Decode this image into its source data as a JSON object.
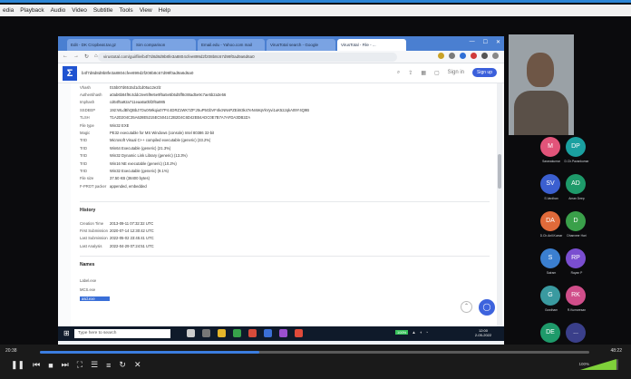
{
  "menubar": [
    "edia",
    "Playback",
    "Audio",
    "Video",
    "Subtitle",
    "Tools",
    "View",
    "Help"
  ],
  "browser": {
    "tabs": [
      {
        "label": "Edit - DK Cropbeat.tar.gz"
      },
      {
        "label": "Sim comparison"
      },
      {
        "label": "Email.edu - Yahoo.com mail"
      },
      {
        "label": "VirusTotal search - Google"
      },
      {
        "label": "VirusTotal - File - ..."
      }
    ],
    "url": "virustotal.com/gui/file/b4f7d8d8d9b8fe3a8804cfee899d2f208b8c67d99f0ad9a6d6a0",
    "window_buttons": [
      "—",
      "☐",
      "✕"
    ]
  },
  "vt": {
    "logo": "Σ",
    "search_value": "b4f7d8d8d9b8fe3a8804cfee899d2f208b8c67d99f0ad9a6d6a0",
    "sign_in": "Sign in",
    "sign_up": "Sign up",
    "details": [
      {
        "k": "Vhash",
        "v": "015b07d6515d1d1d05a12e2lz"
      },
      {
        "k": "Authentihash",
        "v": "a0ab6b84f9c4ddc3ee5f9e5e9f5a5e5b5d5ff8c88ad5e9c7ae5b2a3e56"
      },
      {
        "k": "Imphash",
        "v": "cd64f5a92a711eaa6a0bf2f6a985"
      },
      {
        "k": "SSDEEP",
        "v": "192:WLdBhQBbJ7Ou0rMkqiu07P4:4DRZ1WK7ZP:z5uP5GbVF4kcNNsPZEi8r3k47eNnMqVkVyvi1uK52JqkA09Y4Q9B"
      },
      {
        "k": "TLSH",
        "v": "T1A2D204C35A628E5215EC5041C2B2D4C6D42EB4ADC0E7B7A7AFDA3DB2ZA"
      },
      {
        "k": "File type",
        "v": "Win32 EXE"
      },
      {
        "k": "Magic",
        "v": "PE32 executable for MS Windows (console) Intel 80386 32-bit"
      },
      {
        "k": "TrID",
        "v": "Microsoft Visual C++ compiled executable (generic) (33.2%)"
      },
      {
        "k": "TrID",
        "v": "Win64 Executable (generic) (21.3%)"
      },
      {
        "k": "TrID",
        "v": "Win32 Dynamic Link Library (generic) (13.3%)"
      },
      {
        "k": "TrID",
        "v": "Win16 NE executable (generic) (10.2%)"
      },
      {
        "k": "TrID",
        "v": "Win32 Executable (generic) (9.1%)"
      },
      {
        "k": "File size",
        "v": "37.50 KB (38400 bytes)"
      },
      {
        "k": "F-PROT packer",
        "v": "appended, embedded"
      }
    ],
    "history_title": "History",
    "history": [
      {
        "k": "Creation Time",
        "v": "2013-09-11 07:32:32 UTC"
      },
      {
        "k": "First Submission",
        "v": "2020-07-14 12:30:42 UTC"
      },
      {
        "k": "Last Submission",
        "v": "2022-05-02 23:45:41 UTC"
      },
      {
        "k": "Last Analysis",
        "v": "2022-04-29 07:24:51 UTC"
      }
    ],
    "names_title": "Names",
    "names": [
      {
        "k": "Label.exe",
        "v": ""
      },
      {
        "k": "MCS.exe",
        "v": ""
      },
      {
        "k": "asd.exe",
        "v": ""
      }
    ],
    "scroll_top_icon": "⌃",
    "chat_icon": "◯"
  },
  "taskbar": {
    "search_placeholder": "Type here to search",
    "battery": "100%",
    "clock_time": "12:00",
    "clock_date": "2-05-2022"
  },
  "participants": [
    {
      "initials": "M",
      "name": "Saranakumar",
      "color": "#e2547a"
    },
    {
      "initials": "DP",
      "name": "D.Ch.Pavankumar",
      "color": "#1aa0a0"
    },
    {
      "initials": "SV",
      "name": "S.Vardhan",
      "color": "#3b5fd0"
    },
    {
      "initials": "AD",
      "name": "Aman Deep",
      "color": "#1e9a6a"
    },
    {
      "initials": "DA",
      "name": "D.Ch.Anil.Kumar",
      "color": "#e06a3a"
    },
    {
      "initials": "D",
      "name": "Dhanveer Hari",
      "color": "#3aa04a"
    },
    {
      "initials": "S",
      "name": "Sairam",
      "color": "#3b7fd0"
    },
    {
      "initials": "RP",
      "name": "Rayan P",
      "color": "#7a4ed0"
    },
    {
      "initials": "G",
      "name": "Gowtham",
      "color": "#3a9aa0"
    },
    {
      "initials": "RK",
      "name": "R.Kumaresan",
      "color": "#d04e8a"
    },
    {
      "initials": "DE",
      "name": "Dinesh E",
      "color": "#1e9a6a"
    },
    {
      "initials": "...",
      "name": "",
      "color": "#3a3f8a"
    }
  ],
  "player": {
    "current_time": "20:38",
    "total_time": "48:22",
    "progress_fraction": 0.4,
    "volume_label": "100%",
    "volume_fraction": 0.95
  }
}
